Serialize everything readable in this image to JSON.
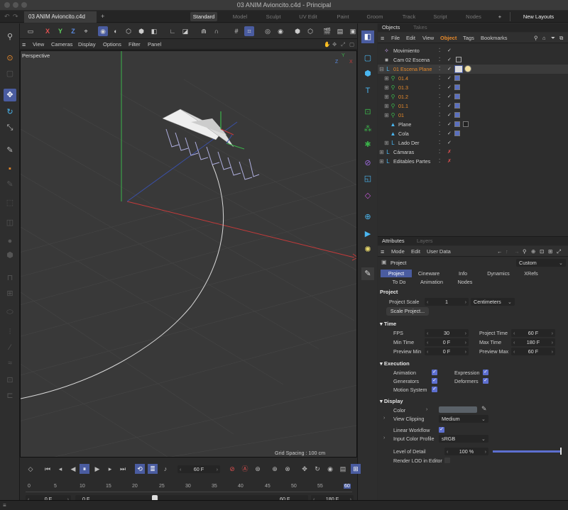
{
  "window": {
    "title": "03 ANIM Avioncito.c4d - Principal"
  },
  "doc_tab": {
    "label": "03 ANIM Avioncito.c4d",
    "add": "+"
  },
  "layouts": {
    "tabs": [
      "Standard",
      "Model",
      "Sculpt",
      "UV Edit",
      "Paint",
      "Groom",
      "Track",
      "Script",
      "Nodes"
    ],
    "active": "Standard",
    "add": "+",
    "new_layouts": "New Layouts"
  },
  "toolbar": {
    "x": "X",
    "y": "Y",
    "z": "Z"
  },
  "viewport": {
    "menu": [
      "View",
      "Cameras",
      "Display",
      "Options",
      "Filter",
      "Panel"
    ],
    "label": "Perspective",
    "grid_spacing": "Grid Spacing : 100 cm",
    "axis_labels": {
      "y": "Y",
      "z": "Z",
      "x": "X"
    }
  },
  "objects_panel": {
    "tabs": [
      "Objects",
      "Takes"
    ],
    "menu": [
      "File",
      "Edit",
      "View",
      "Object",
      "Tags",
      "Bookmarks"
    ],
    "active_menu": "Object",
    "rows": [
      {
        "name": "Movimiento",
        "indent": 0
      },
      {
        "name": "Cam 02 Escena",
        "indent": 0
      },
      {
        "name": "01 Escena Plane",
        "indent": 0,
        "selected": true
      },
      {
        "name": "01.4",
        "indent": 1
      },
      {
        "name": "01.3",
        "indent": 1
      },
      {
        "name": "01.2",
        "indent": 1
      },
      {
        "name": "01.1",
        "indent": 1
      },
      {
        "name": "01",
        "indent": 1
      },
      {
        "name": "Plane",
        "indent": 1
      },
      {
        "name": "Cola",
        "indent": 1
      },
      {
        "name": "Lado Der",
        "indent": 1
      },
      {
        "name": "Cámaras",
        "indent": 0
      },
      {
        "name": "Editables Partes",
        "indent": 0
      }
    ]
  },
  "attributes": {
    "tabs": [
      "Attributes",
      "Layers"
    ],
    "menu": [
      "Mode",
      "Edit",
      "User Data"
    ],
    "object_label": "Project",
    "preset": "Custom",
    "subtabs_row1": [
      "Project",
      "Cineware",
      "Info",
      "Dynamics",
      "XRefs"
    ],
    "subtabs_row2": [
      "To Do",
      "Animation",
      "Nodes"
    ],
    "active_subtab": "Project",
    "project_header": "Project",
    "project_scale_label": "Project Scale",
    "project_scale_value": "1",
    "project_scale_unit": "Centimeters",
    "scale_button": "Scale Project...",
    "time_header": "Time",
    "fps_label": "FPS",
    "fps_value": "30",
    "project_time_label": "Project Time",
    "project_time_value": "60 F",
    "min_time_label": "Min Time",
    "min_time_value": "0 F",
    "max_time_label": "Max Time",
    "max_time_value": "180 F",
    "preview_min_label": "Preview Min",
    "preview_min_value": "0 F",
    "preview_max_label": "Preview Max",
    "preview_max_value": "60 F",
    "execution_header": "Execution",
    "animation_label": "Animation",
    "expression_label": "Expression",
    "generators_label": "Generators",
    "deformers_label": "Deformers",
    "motion_system_label": "Motion System",
    "display_header": "Display",
    "color_label": "Color",
    "color_value": "#5a6168",
    "view_clipping_label": "View Clipping",
    "view_clipping_value": "Medium",
    "linear_workflow_label": "Linear Workflow",
    "input_color_profile_label": "Input Color Profile",
    "input_color_profile_value": "sRGB",
    "level_of_detail_label": "Level of Detail",
    "level_of_detail_value": "100 %",
    "render_lod_label": "Render LOD in Editor"
  },
  "timeline": {
    "current_frame": "60 F",
    "ticks": [
      "0",
      "5",
      "10",
      "15",
      "20",
      "25",
      "30",
      "35",
      "40",
      "45",
      "50",
      "55",
      "60"
    ],
    "start_a": "0 F",
    "start_b": "0 F",
    "end_a": "60 F",
    "end_b": "180 F"
  },
  "colors": {
    "accent": "#4a5ca0",
    "selection_orange": "#e6892a",
    "icon_blue": "#4ab6f0",
    "axis_red": "#c43a3a",
    "axis_green": "#3bb24a"
  }
}
